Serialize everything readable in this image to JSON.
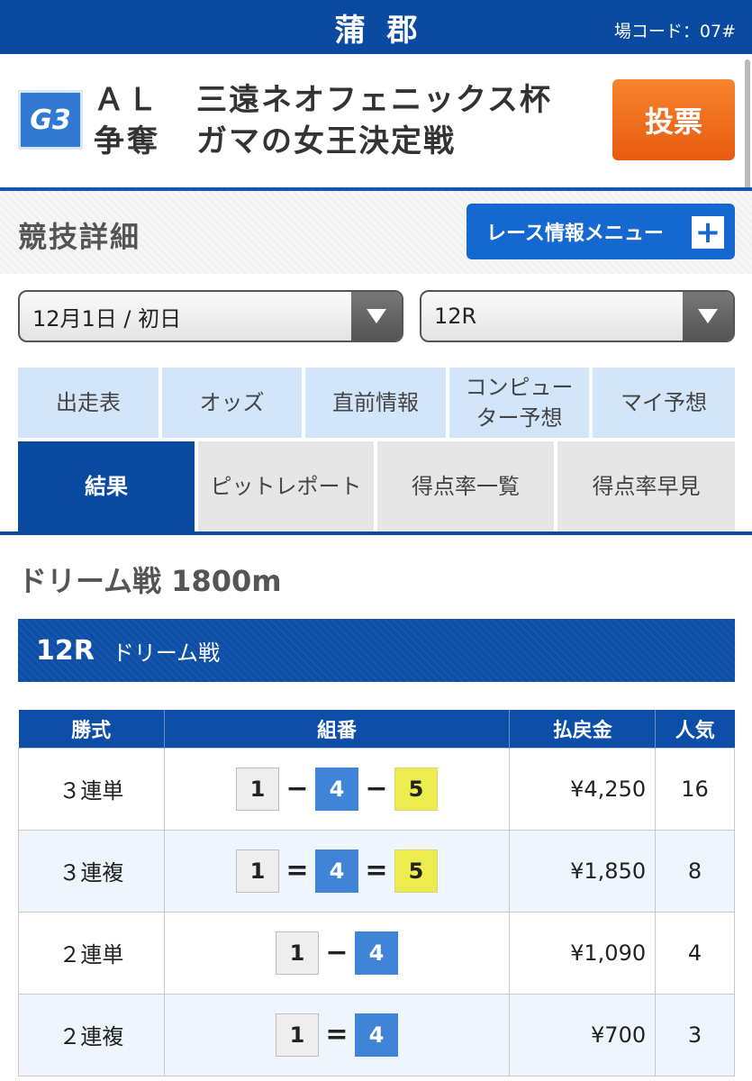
{
  "topbar": {
    "venue": "蒲郡",
    "code": "場コード：07#"
  },
  "race_header": {
    "grade": "G3",
    "title_left_1": "ＡＬ",
    "title_left_2": "争奪",
    "title_right_1": "三遠ネオフェニックス杯",
    "title_right_2": "ガマの女王決定戦",
    "vote_label": "投票"
  },
  "section": {
    "title": "競技詳細",
    "menu_label": "レース情報メニュー",
    "menu_plus": "+"
  },
  "selects": {
    "day": "12月1日 / 初日",
    "race": "12R"
  },
  "tabs_row1": [
    "出走表",
    "オッズ",
    "直前情報",
    "コンピューター予想",
    "マイ予想"
  ],
  "tabs_row2": [
    "結果",
    "ピットレポート",
    "得点率一覧",
    "得点率早見"
  ],
  "race": {
    "title": "ドリーム戦 1800m",
    "number": "12R",
    "name": "ドリーム戦"
  },
  "results": {
    "headers": [
      "勝式",
      "組番",
      "払戻金",
      "人気"
    ],
    "rows": [
      {
        "type": "３連単",
        "n1": "1",
        "s1": "−",
        "n2": "4",
        "s2": "−",
        "n3": "5",
        "payout": "¥4,250",
        "pop": "16"
      },
      {
        "type": "３連複",
        "n1": "1",
        "s1": "=",
        "n2": "4",
        "s2": "=",
        "n3": "5",
        "payout": "¥1,850",
        "pop": "8"
      },
      {
        "type": "２連単",
        "n1": "1",
        "s1": "−",
        "n2": "4",
        "payout": "¥1,090",
        "pop": "4"
      },
      {
        "type": "２連複",
        "n1": "1",
        "s1": "=",
        "n2": "4",
        "payout": "¥700",
        "pop": "3"
      }
    ]
  }
}
